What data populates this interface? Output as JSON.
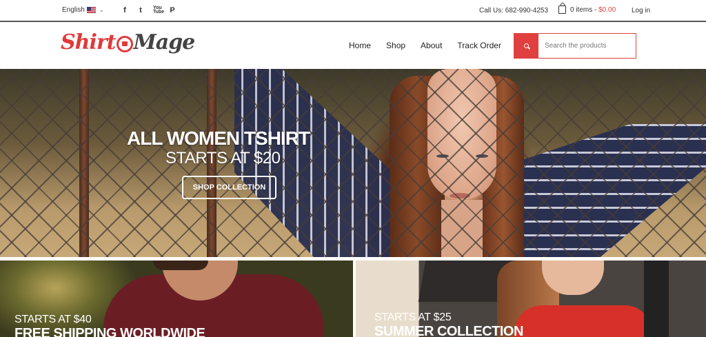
{
  "topbar": {
    "language": "English",
    "social": [
      "f",
      "t",
      "You Tube",
      "P"
    ],
    "call": "Call Us: 682-990-4253",
    "cart_items": "0 items",
    "cart_sep": " - ",
    "cart_price": "$0.00",
    "login": "Log in"
  },
  "header": {
    "logo_left": "Shirt",
    "logo_right": "Mage",
    "nav": [
      "Home",
      "Shop",
      "About",
      "Track Order"
    ],
    "search_placeholder": "Search the products"
  },
  "hero": {
    "title": "ALL WOMEN TSHIRT",
    "subtitle": "STARTS AT $20",
    "button": "SHOP COLLECTION"
  },
  "promos": [
    {
      "subtitle": "STARTS AT $40",
      "title": "FREE SHIPPING WORLDWIDE"
    },
    {
      "subtitle": "STARTS AT $25",
      "title": "SUMMER COLLECTION"
    }
  ],
  "colors": {
    "accent": "#e04040"
  }
}
